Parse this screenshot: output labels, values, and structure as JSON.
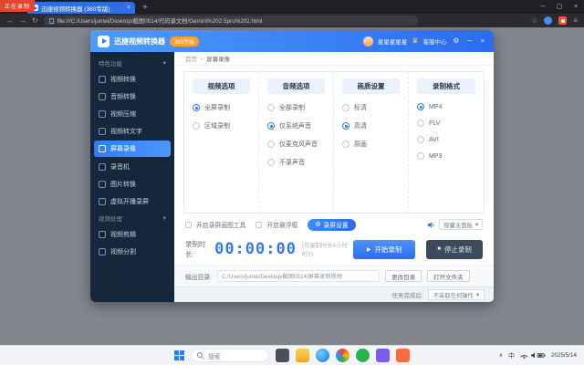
{
  "overlay": {
    "recording_badge": "正在录制"
  },
  "icons": {
    "back": "←",
    "forward": "→",
    "reload": "↻",
    "close": "×",
    "minimize": "─",
    "maximize": "▢",
    "plus": "+",
    "star": "☆",
    "menu": "≡",
    "crown": "♛",
    "gear": "⚙",
    "play": "▶",
    "stop": "■",
    "caret": "▾",
    "chevron_up": "∧",
    "sep": "›"
  },
  "browser": {
    "tab_title": "迅捷视频转换器 (360专版)",
    "url": "file:///C:/Users/jumei/Desktop/截图0514/代码录文档/Gemini%202.5pro%202.html"
  },
  "app": {
    "titlebar": {
      "title": "迅捷视频转换器",
      "badge": "360专版",
      "username": "星星星星星",
      "service": "客服中心"
    },
    "sidebar": {
      "section1": "特色功能",
      "section2": "视频处理",
      "items": [
        {
          "label": "视频转换"
        },
        {
          "label": "音频转换"
        },
        {
          "label": "视频压缩"
        },
        {
          "label": "视频转文字"
        },
        {
          "label": "屏幕录像"
        },
        {
          "label": "录音机"
        },
        {
          "label": "图片转换"
        },
        {
          "label": "虚拟开播录屏"
        }
      ],
      "items2": [
        {
          "label": "视频剪辑"
        },
        {
          "label": "视频分割"
        }
      ]
    },
    "breadcrumb": {
      "home": "首页",
      "sep": "›",
      "current": "屏幕录像"
    },
    "panels": [
      {
        "title": "视频选项",
        "options": [
          {
            "label": "全屏录制",
            "selected": true
          },
          {
            "label": "区域录制",
            "selected": false
          }
        ]
      },
      {
        "title": "音频选项",
        "options": [
          {
            "label": "全部录制",
            "selected": false
          },
          {
            "label": "仅系统声音",
            "selected": true
          },
          {
            "label": "仅麦克风声音",
            "selected": false
          },
          {
            "label": "不录声音",
            "selected": false
          }
        ]
      },
      {
        "title": "画质设置",
        "options": [
          {
            "label": "标清",
            "selected": false
          },
          {
            "label": "高清",
            "selected": true
          },
          {
            "label": "原画",
            "selected": false
          }
        ]
      },
      {
        "title": "录制格式",
        "options": [
          {
            "label": "MP4",
            "selected": true
          },
          {
            "label": "FLV",
            "selected": false
          },
          {
            "label": "AVI",
            "selected": false
          },
          {
            "label": "MP3",
            "selected": false
          }
        ]
      }
    ],
    "toolbar": {
      "checkbox1": "开启录屏画图工具",
      "checkbox2": "开启悬浮框",
      "settings_button": "录屏设置",
      "panel_dropdown": "隐藏主面板"
    },
    "timer": {
      "label": "录制时长:",
      "value": "00:00:00",
      "note": "(可录制时长4小时8分)",
      "start_button": "开始录制",
      "stop_button": "停止录制"
    },
    "output": {
      "label": "输出目录:",
      "path": "C:/Users/jumei/Desktop/截图0514/屏幕录制视频",
      "change_button": "更改目录",
      "open_button": "打开文件夹"
    },
    "statusbar": {
      "label": "任务完成后:",
      "value": "不采取任何操作"
    }
  },
  "taskbar": {
    "search": "搜索",
    "ime": "中",
    "date": "2025/5/14"
  }
}
